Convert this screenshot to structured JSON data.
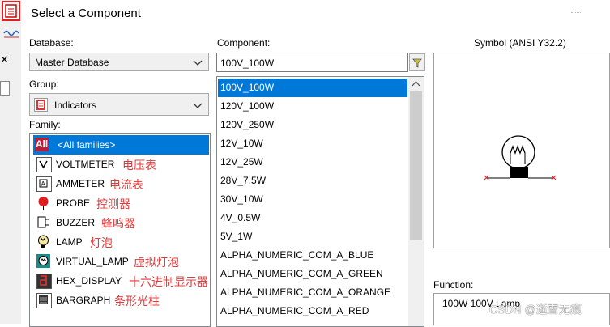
{
  "title": "Select a Component",
  "database": {
    "label": "Database:",
    "value": "Master Database"
  },
  "group": {
    "label": "Group:",
    "value": "Indicators"
  },
  "family": {
    "label": "Family:",
    "items": [
      {
        "name": "<All families>",
        "annotation": "",
        "icon": "all-families-icon"
      },
      {
        "name": "VOLTMETER",
        "annotation": "电压表",
        "icon": "voltmeter-icon"
      },
      {
        "name": "AMMETER",
        "annotation": "电流表",
        "icon": "ammeter-icon"
      },
      {
        "name": "PROBE",
        "annotation": "控测器",
        "icon": "probe-icon"
      },
      {
        "name": "BUZZER",
        "annotation": "蜂鸣器",
        "icon": "buzzer-icon"
      },
      {
        "name": "LAMP",
        "annotation": "灯泡",
        "icon": "lamp-icon"
      },
      {
        "name": "VIRTUAL_LAMP",
        "annotation": "虚拟灯泡",
        "icon": "virtual-lamp-icon"
      },
      {
        "name": "HEX_DISPLAY",
        "annotation": "十六进制显示器",
        "icon": "hex-display-icon"
      },
      {
        "name": "BARGRAPH",
        "annotation": "条形光柱",
        "icon": "bargraph-icon"
      }
    ]
  },
  "component": {
    "label": "Component:",
    "value": "100V_100W",
    "items": [
      "100V_100W",
      "120V_100W",
      "120V_250W",
      "12V_10W",
      "12V_25W",
      "28V_7.5W",
      "30V_10W",
      "4V_0.5W",
      "5V_1W",
      "ALPHA_NUMERIC_COM_A_BLUE",
      "ALPHA_NUMERIC_COM_A_GREEN",
      "ALPHA_NUMERIC_COM_A_ORANGE",
      "ALPHA_NUMERIC_COM_A_RED"
    ]
  },
  "symbol": {
    "label": "Symbol (ANSI Y32.2)"
  },
  "function": {
    "label": "Function:",
    "value": "100W 100V Lamp"
  },
  "watermark": "CSDN @逝雪无痕",
  "colors": {
    "selection": "#0078d7",
    "annotation": "#e53a3a"
  }
}
